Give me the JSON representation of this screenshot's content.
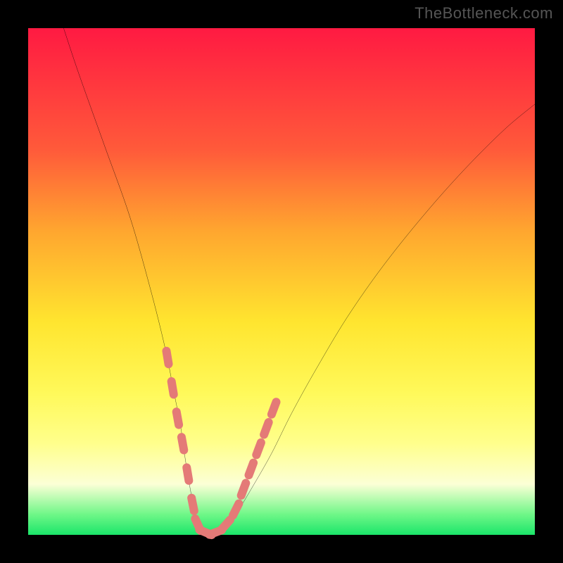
{
  "watermark": "TheBottleneck.com",
  "colors": {
    "gradient_top": "#ff1a42",
    "gradient_mid1": "#ffa62f",
    "gradient_mid2": "#ffe52f",
    "gradient_bottom": "#1be56a",
    "curve": "#000000",
    "marker": "#e47a77",
    "frame": "#000000"
  },
  "chart_data": {
    "type": "line",
    "title": "",
    "xlabel": "",
    "ylabel": "",
    "xlim": [
      0,
      100
    ],
    "ylim": [
      0,
      100
    ],
    "grid": false,
    "series": [
      {
        "name": "curve",
        "x": [
          7,
          10,
          15,
          20,
          24,
          27,
          29,
          30,
          31,
          32,
          33,
          34,
          35,
          37,
          39,
          41,
          44,
          48,
          52,
          57,
          63,
          70,
          78,
          86,
          94,
          100
        ],
        "y": [
          100,
          91,
          77,
          63,
          49,
          37,
          27,
          22,
          15,
          9,
          4,
          1,
          0,
          0,
          1,
          4,
          9,
          16,
          24,
          33,
          43,
          53,
          63,
          72,
          80,
          85
        ]
      }
    ],
    "markers": [
      {
        "x": 27.5,
        "y": 35
      },
      {
        "x": 28.5,
        "y": 29
      },
      {
        "x": 29.5,
        "y": 23
      },
      {
        "x": 30.5,
        "y": 18
      },
      {
        "x": 31.5,
        "y": 12
      },
      {
        "x": 32.5,
        "y": 6
      },
      {
        "x": 33.5,
        "y": 2
      },
      {
        "x": 35.0,
        "y": 0.5
      },
      {
        "x": 37.0,
        "y": 0.5
      },
      {
        "x": 39.0,
        "y": 2
      },
      {
        "x": 41.0,
        "y": 5
      },
      {
        "x": 42.5,
        "y": 9
      },
      {
        "x": 44.0,
        "y": 13
      },
      {
        "x": 45.5,
        "y": 17
      },
      {
        "x": 47.0,
        "y": 21
      },
      {
        "x": 48.5,
        "y": 25
      }
    ],
    "marker_size": 12
  }
}
